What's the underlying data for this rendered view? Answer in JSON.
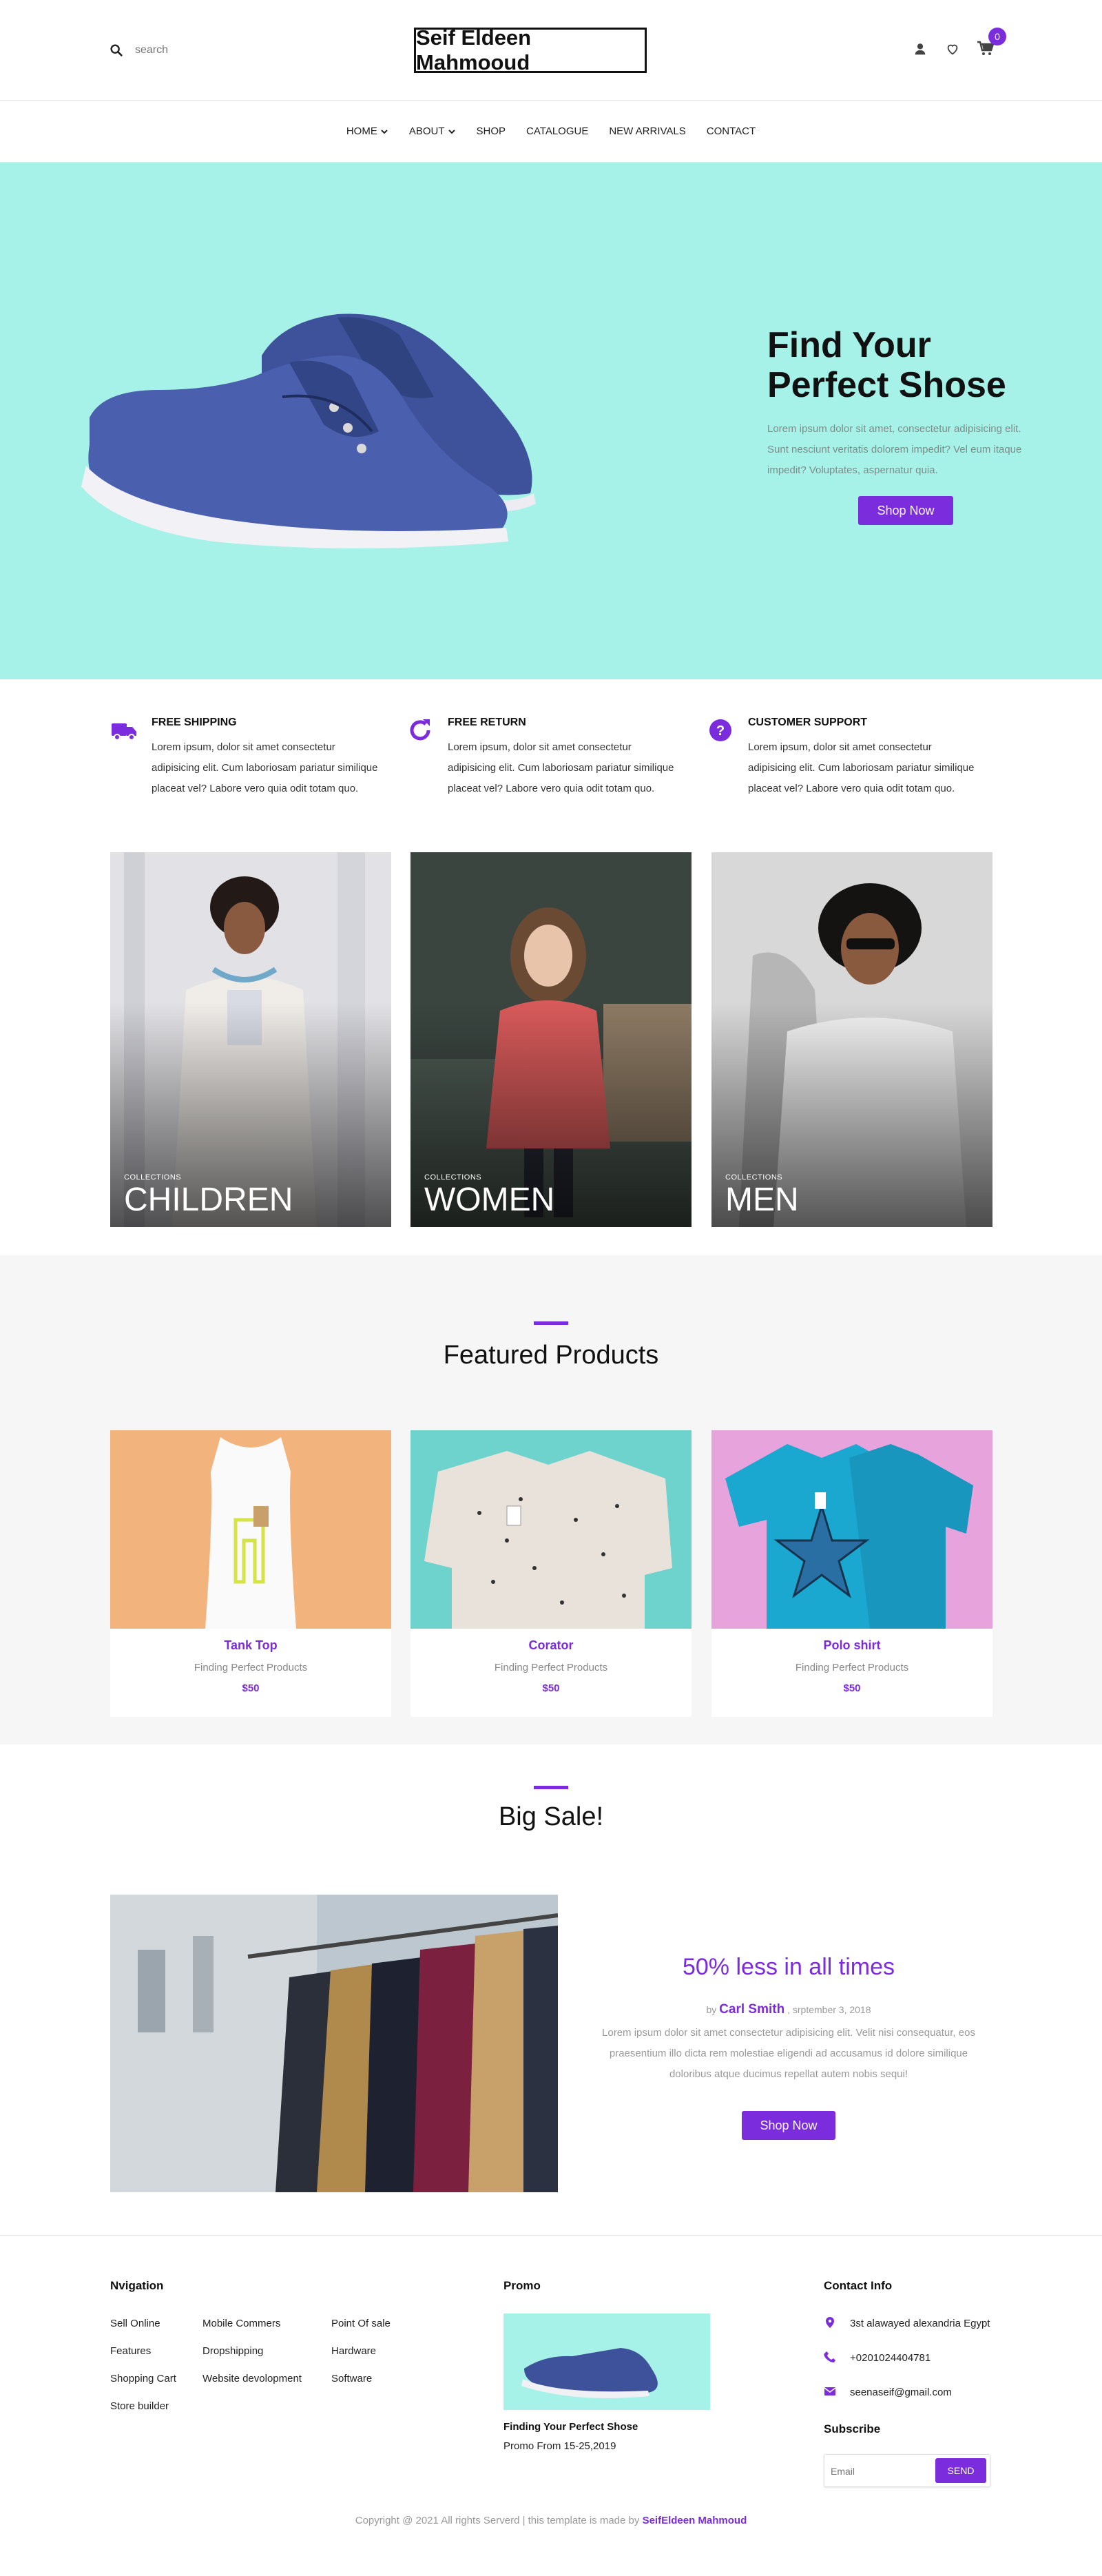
{
  "colors": {
    "accent": "#7b2cdc",
    "hero_bg": "#a7f2e8",
    "section_bg": "#f6f6f6"
  },
  "header": {
    "search_placeholder": "search",
    "brand": "Seif Eldeen Mahmooud",
    "cart_count": "0",
    "icons": [
      "search-icon",
      "user-icon",
      "heart-icon",
      "cart-icon"
    ]
  },
  "nav": {
    "items": [
      {
        "label": "HOME",
        "dropdown": true
      },
      {
        "label": "ABOUT",
        "dropdown": true
      },
      {
        "label": "SHOP",
        "dropdown": false
      },
      {
        "label": "CATALOGUE",
        "dropdown": false
      },
      {
        "label": "NEW ARRIVALS",
        "dropdown": false
      },
      {
        "label": "CONTACT",
        "dropdown": false
      }
    ]
  },
  "hero": {
    "title": "Find Your Perfect Shose",
    "text": "Lorem ipsum dolor sit amet, consectetur adipisicing elit. Sunt nesciunt veritatis dolorem impedit? Vel eum itaque impedit? Voluptates, aspernatur quia.",
    "button": "Shop Now"
  },
  "features": [
    {
      "title": "FREE SHIPPING",
      "text": "Lorem ipsum, dolor sit amet consectetur adipisicing elit. Cum laboriosam pariatur similique placeat vel? Labore vero quia odit totam quo.",
      "icon": "truck-icon"
    },
    {
      "title": "FREE RETURN",
      "text": "Lorem ipsum, dolor sit amet consectetur adipisicing elit. Cum laboriosam pariatur similique placeat vel? Labore vero quia odit totam quo.",
      "icon": "refresh-icon"
    },
    {
      "title": "CUSTOMER SUPPORT",
      "text": "Lorem ipsum, dolor sit amet consectetur adipisicing elit. Cum laboriosam pariatur similique placeat vel? Labore vero quia odit totam quo.",
      "icon": "question-icon"
    }
  ],
  "collections": [
    {
      "sub": "COLLECTIONS",
      "title": "CHILDREN"
    },
    {
      "sub": "COLLECTIONS",
      "title": "WOMEN"
    },
    {
      "sub": "COLLECTIONS",
      "title": "MEN"
    }
  ],
  "featured": {
    "title": "Featured Products",
    "products": [
      {
        "name": "Tank Top",
        "desc": "Finding Perfect Products",
        "price": "$50"
      },
      {
        "name": "Corator",
        "desc": "Finding Perfect Products",
        "price": "$50"
      },
      {
        "name": "Polo shirt",
        "desc": "Finding Perfect Products",
        "price": "$50"
      }
    ]
  },
  "sale": {
    "title": "Big Sale!",
    "heading": "50% less in all times",
    "by": "by",
    "author": "Carl Smith",
    "date": ", srptember 3, 2018",
    "text": "Lorem ipsum dolor sit amet consectetur adipisicing elit. Velit nisi consequatur, eos praesentium illo dicta rem molestiae eligendi ad accusamus id dolore similique doloribus atque ducimus repellat autem nobis sequi!",
    "button": "Shop Now"
  },
  "footer": {
    "nav_title": "Nvigation",
    "nav_col1": [
      "Sell Online",
      "Features",
      "Shopping Cart",
      "Store builder"
    ],
    "nav_col2": [
      "Mobile Commers",
      "Dropshipping",
      "Website devolopment"
    ],
    "nav_col3": [
      "Point Of sale",
      "Hardware",
      "Software"
    ],
    "promo_title": "Promo",
    "promo_heading": "Finding Your Perfect Shose",
    "promo_date": "Promo From 15-25,2019",
    "contact_title": "Contact Info",
    "contact": [
      {
        "icon": "location-icon",
        "text": "3st alawayed alexandria Egypt"
      },
      {
        "icon": "phone-icon",
        "text": "+0201024404781"
      },
      {
        "icon": "mail-icon",
        "text": "seenaseif@gmail.com"
      }
    ],
    "subscribe_title": "Subscribe",
    "email_placeholder": "Email",
    "send": "SEND",
    "copyright": "Copyright @ 2021 All rights Serverd | this template is made by ",
    "copyright_name": "SeifEldeen Mahmoud"
  }
}
